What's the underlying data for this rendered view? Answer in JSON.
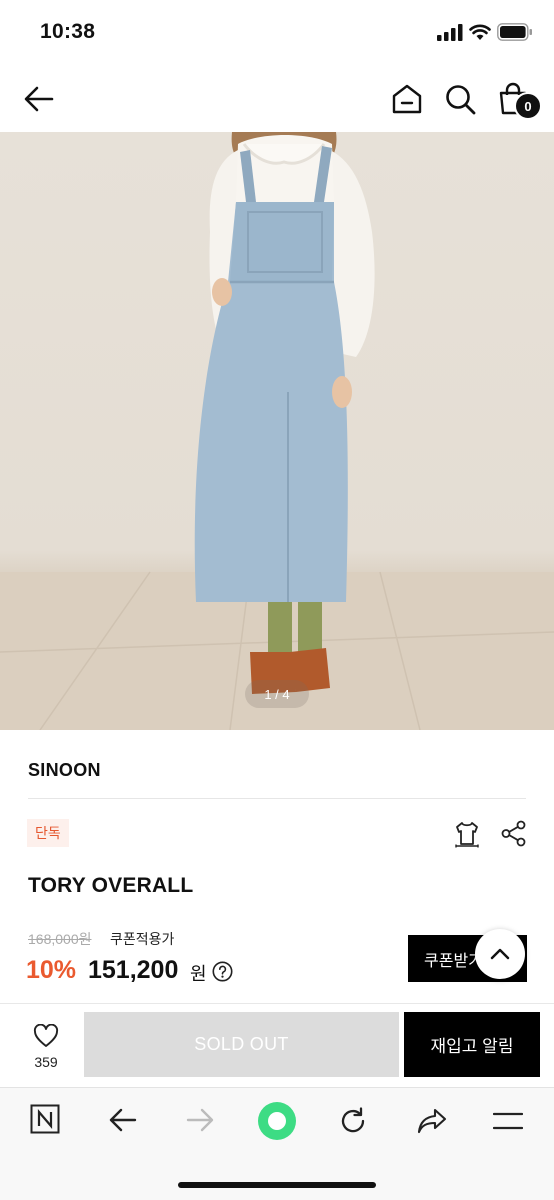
{
  "status_bar": {
    "time": "10:38"
  },
  "header": {
    "cart_count": "0"
  },
  "gallery": {
    "pager": "1 / 4"
  },
  "product": {
    "brand": "SINOON",
    "badge": "단독",
    "name": "TORY OVERALL",
    "original_price": "168,000원",
    "coupon_label": "쿠폰적용가",
    "discount": "10%",
    "price": "151,200",
    "currency": "원",
    "coupon_button": "쿠폰받기"
  },
  "actions": {
    "like_count": "359",
    "sold_out": "SOLD OUT",
    "restock": "재입고 알림"
  },
  "colors": {
    "accent": "#ea5a2f",
    "badge_bg": "#fdf0ec",
    "sold_out_bg": "#dcdcdc",
    "primary_button": "#000000",
    "browser_green": "#3ddc84"
  },
  "icons": [
    "back-icon",
    "home-icon",
    "search-icon",
    "cart-icon",
    "shirt-icon",
    "share-icon",
    "help-icon",
    "chevron-up-icon",
    "heart-icon",
    "naver-icon",
    "arrow-left-icon",
    "arrow-right-icon",
    "green-dot-icon",
    "refresh-icon",
    "share-arrow-icon",
    "menu-icon"
  ]
}
